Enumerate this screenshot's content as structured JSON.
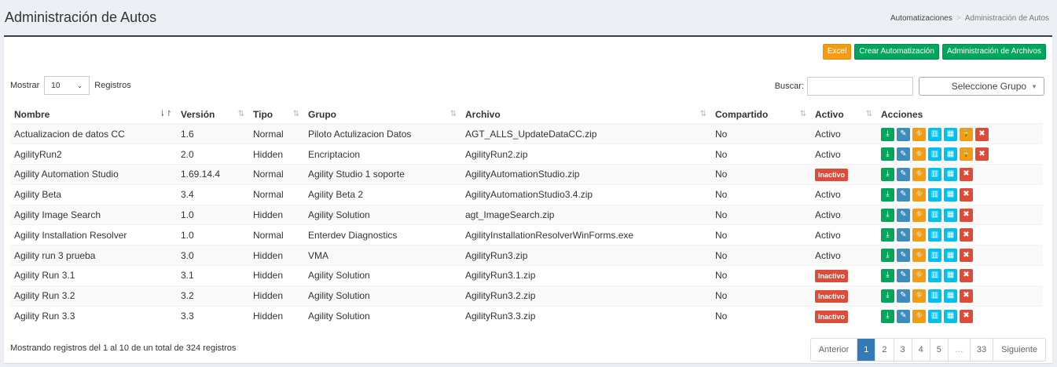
{
  "header": {
    "title": "Administración de Autos",
    "breadcrumb": {
      "root": "Automatizaciones",
      "separator": ">",
      "current": "Administración de Autos"
    }
  },
  "toolbar": {
    "excel": "Excel",
    "create": "Crear Automatización",
    "files": "Administración de Archivos"
  },
  "length": {
    "prefix": "Mostrar",
    "value": "10",
    "suffix": "Registros"
  },
  "search": {
    "label": "Buscar:",
    "value": ""
  },
  "group_select": {
    "value": "Seleccione Grupo"
  },
  "table": {
    "headers": [
      "Nombre",
      "Versión",
      "Tipo",
      "Grupo",
      "Archivo",
      "Compartido",
      "Activo",
      "Acciones"
    ],
    "rows": [
      {
        "nombre": "Actualizacion de datos CC",
        "version": "1.6",
        "tipo": "Normal",
        "grupo": "Piloto Actulizacion Datos",
        "archivo": "AGT_ALLS_UpdateDataCC.zip",
        "compartido": "No",
        "activo": "Activo",
        "lock": true
      },
      {
        "nombre": "AgilityRun2",
        "version": "2.0",
        "tipo": "Hidden",
        "grupo": "Encriptacion",
        "archivo": "AgilityRun2.zip",
        "compartido": "No",
        "activo": "Activo",
        "lock": true
      },
      {
        "nombre": "Agility Automation Studio",
        "version": "1.69.14.4",
        "tipo": "Normal",
        "grupo": "Agility Studio 1 soporte",
        "archivo": "AgilityAutomationStudio.zip",
        "compartido": "No",
        "activo": "Inactivo",
        "lock": false
      },
      {
        "nombre": "Agility Beta",
        "version": "3.4",
        "tipo": "Normal",
        "grupo": "Agility Beta 2",
        "archivo": "AgilityAutomationStudio3.4.zip",
        "compartido": "No",
        "activo": "Activo",
        "lock": false
      },
      {
        "nombre": "Agility Image Search",
        "version": "1.0",
        "tipo": "Hidden",
        "grupo": "Agility Solution",
        "archivo": "agt_ImageSearch.zip",
        "compartido": "No",
        "activo": "Activo",
        "lock": false
      },
      {
        "nombre": "Agility Installation Resolver",
        "version": "1.0",
        "tipo": "Normal",
        "grupo": "Enterdev Diagnostics",
        "archivo": "AgilityInstallationResolverWinForms.exe",
        "compartido": "No",
        "activo": "Activo",
        "lock": false
      },
      {
        "nombre": "Agility run 3 prueba",
        "version": "3.0",
        "tipo": "Hidden",
        "grupo": "VMA",
        "archivo": "AgilityRun3.zip",
        "compartido": "No",
        "activo": "Activo",
        "lock": false
      },
      {
        "nombre": "Agility Run 3.1",
        "version": "3.1",
        "tipo": "Hidden",
        "grupo": "Agility Solution",
        "archivo": "AgilityRun3.1.zip",
        "compartido": "No",
        "activo": "Inactivo",
        "lock": false
      },
      {
        "nombre": "Agility Run 3.2",
        "version": "3.2",
        "tipo": "Hidden",
        "grupo": "Agility Solution",
        "archivo": "AgilityRun3.2.zip",
        "compartido": "No",
        "activo": "Inactivo",
        "lock": false
      },
      {
        "nombre": "Agility Run 3.3",
        "version": "3.3",
        "tipo": "Hidden",
        "grupo": "Agility Solution",
        "archivo": "AgilityRun3.3.zip",
        "compartido": "No",
        "activo": "Inactivo",
        "lock": false
      }
    ]
  },
  "info": "Mostrando registros del 1 al 10 de un total de 324 registros",
  "pagination": {
    "prev": "Anterior",
    "pages": [
      "1",
      "2",
      "3",
      "4",
      "5",
      "…",
      "33"
    ],
    "active": "1",
    "next": "Siguiente"
  },
  "colors": {
    "green": "#00a65a",
    "blue": "#3c8dbc",
    "orange": "#f39c12",
    "sky": "#00c0ef",
    "red": "#dd4b39",
    "header_border": "#3c3f4d"
  }
}
